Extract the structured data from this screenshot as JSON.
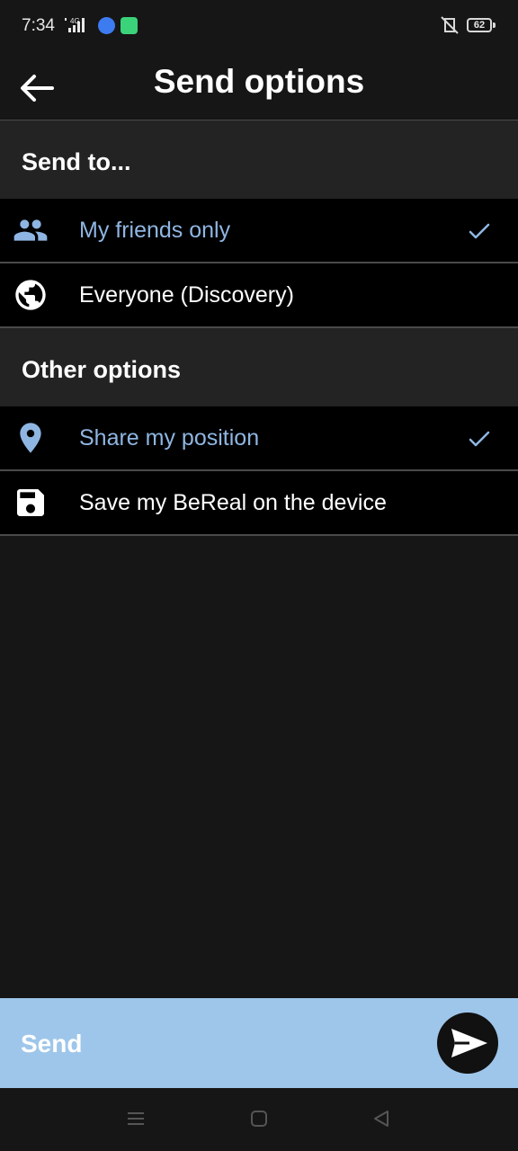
{
  "status_bar": {
    "time": "7:34",
    "network": "4G",
    "battery": "62"
  },
  "header": {
    "title": "Send options",
    "back_icon": "arrow-left-icon"
  },
  "send_to": {
    "heading": "Send to...",
    "options": [
      {
        "label": "My friends only",
        "icon": "people-icon",
        "selected": true
      },
      {
        "label": "Everyone (Discovery)",
        "icon": "globe-icon",
        "selected": false
      }
    ]
  },
  "other_options": {
    "heading": "Other options",
    "options": [
      {
        "label": "Share my position",
        "icon": "location-pin-icon",
        "selected": true
      },
      {
        "label": "Save my BeReal on the device",
        "icon": "save-icon",
        "selected": false
      }
    ]
  },
  "footer": {
    "send_label": "Send",
    "send_icon": "send-icon"
  },
  "colors": {
    "background": "#161616",
    "section": "#232323",
    "row": "#000000",
    "accent": "#9ec6ea",
    "selected_text": "#8fb6e2"
  }
}
